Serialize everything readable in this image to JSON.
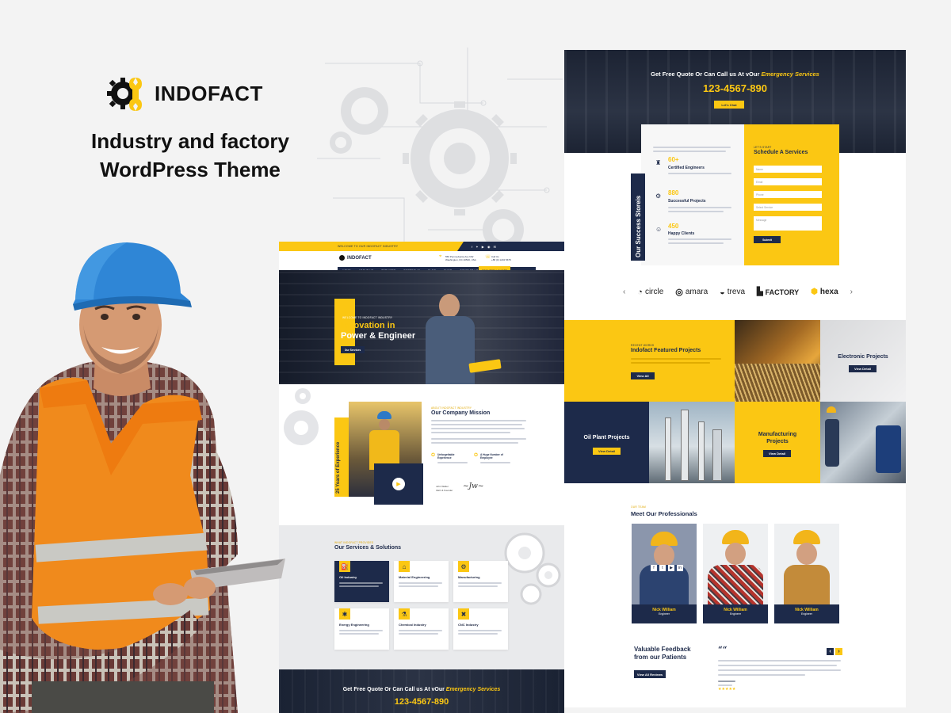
{
  "brand": {
    "name": "INDOFACT",
    "tagline_line1": "Industry and factory",
    "tagline_line2": "WordPress Theme"
  },
  "left_preview": {
    "topbar": {
      "welcome": "WELCOME TO OUR INDOFACT INDUSTRY"
    },
    "header": {
      "logo": "INDOFACT",
      "address_line1": "556 Pennsylvania Ave NW",
      "address_line2": "Washington, DC 20500, USA",
      "phone_line1": "Call Us",
      "phone_line2": "+88 (0) 1234 5678"
    },
    "nav": {
      "items": [
        "HOME",
        "ABOUT US",
        "SERVICES",
        "PORTFOLIO",
        "BLOG",
        "SHOP",
        "CONTACT US"
      ],
      "cta": "REQUEST A QUOTE"
    },
    "hero": {
      "kicker": "WELCOME TO INDOFACT INDUSTRY",
      "title_line1": "Innovation in",
      "title_line2": "Power & Engineer",
      "button": "Our Services"
    },
    "mission": {
      "kicker": "ABOUT INDOFACT INDUSTRY",
      "title": "Our Company Mission",
      "badge": "25 Years of Experience",
      "feature1_line1": "Unforgettable",
      "feature1_line2": "Experience",
      "feature2_line1": "A Huge Number of",
      "feature2_line2": "Employee",
      "signer": "John Walter",
      "signer_role": "CEO & Founder"
    },
    "services": {
      "kicker": "WHAT INDOFACT PROVIDES",
      "title": "Our Services & Solutions",
      "items": [
        {
          "label": "Oil Industry",
          "icon": "oil-drop-icon",
          "glyph": "⛽"
        },
        {
          "label": "Material Engineering",
          "icon": "factory-icon",
          "glyph": "🏭"
        },
        {
          "label": "Manufacturing",
          "icon": "truck-icon",
          "glyph": "⚙"
        },
        {
          "label": "Energy Engineering",
          "icon": "fan-icon",
          "glyph": "✱"
        },
        {
          "label": "Chemical Industry",
          "icon": "flask-icon",
          "glyph": "⚗"
        },
        {
          "label": "CNC Industry",
          "icon": "tools-icon",
          "glyph": "✖"
        }
      ]
    },
    "quote": {
      "text_prefix": "Get Free Quote Or Can Call us At vOur",
      "text_highlight": "Emergency Services",
      "phone": "123-4567-890"
    }
  },
  "right_preview": {
    "quote": {
      "text_prefix": "Get Free Quote Or Can Call us At vOur",
      "text_highlight": "Emergency Services",
      "phone": "123-4567-890",
      "button": "Let's Chat"
    },
    "stats": {
      "vertical_title": "Our Success Storeis",
      "items": [
        {
          "number": "60+",
          "label": "Certified Engineers"
        },
        {
          "number": "880",
          "label": "Successful Projects"
        },
        {
          "number": "450",
          "label": "Happy Clients"
        }
      ]
    },
    "schedule": {
      "kicker": "LET'S START",
      "title": "Schedule A Services",
      "fields": [
        "Name",
        "Email",
        "Phone",
        "Select Service",
        "Message"
      ],
      "button": "Submit"
    },
    "partners": [
      {
        "name": "circle"
      },
      {
        "name": "amara"
      },
      {
        "name": "treva"
      },
      {
        "name": "FACTORY"
      },
      {
        "name": "hexa"
      }
    ],
    "projects": {
      "kicker": "RECENT WORKS",
      "title": "Indofact Featured Projects",
      "button": "View All",
      "cards": [
        {
          "title": "Electronic Projects",
          "button": "View Detail"
        },
        {
          "title": "Oil Plant Projects",
          "button": "View Detail"
        },
        {
          "title_line1": "Manufacturing",
          "title_line2": "Projects",
          "button": "View Detail"
        }
      ]
    },
    "team": {
      "kicker": "OUR TEAM",
      "title": "Meet Our Professionals",
      "members": [
        {
          "name": "Nick William",
          "role": "Engineer"
        },
        {
          "name": "Nick William",
          "role": "Engineer"
        },
        {
          "name": "Nick William",
          "role": "Engineer"
        }
      ]
    },
    "feedback": {
      "title_line1": "Valuable Feedback",
      "title_line2": "from our Patients",
      "button": "View All Reviews",
      "quote_mark": "““",
      "stars": "★★★★★",
      "prev": "‹",
      "next": "›"
    }
  },
  "colors": {
    "yellow": "#fbc713",
    "navy": "#1d2a4a",
    "dark": "#111111"
  }
}
